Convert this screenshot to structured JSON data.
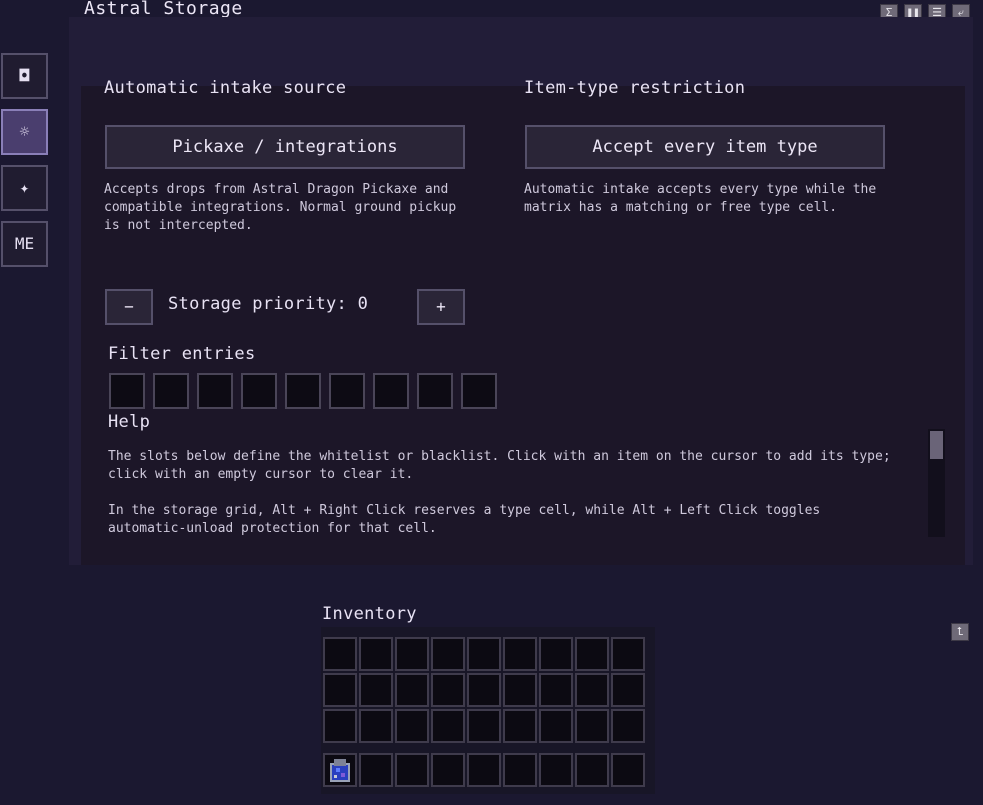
{
  "window": {
    "title": "Astral Storage",
    "controls": [
      "Σ",
      "❚❚",
      "☰",
      "⤶"
    ]
  },
  "sidebar": {
    "tabs": [
      {
        "label": "◘",
        "name": "overview"
      },
      {
        "label": "☼",
        "name": "settings"
      },
      {
        "label": "✦",
        "name": "astral"
      },
      {
        "label": "ME",
        "name": "me-network"
      }
    ]
  },
  "intake": {
    "heading": "Automatic intake source",
    "button_label": "Pickaxe / integrations",
    "description": "Accepts drops from Astral Dragon Pickaxe and compatible integrations. Normal ground pickup is not intercepted."
  },
  "restriction": {
    "heading": "Item-type restriction",
    "button_label": "Accept every item type",
    "description": "Automatic intake accepts every type while the matrix has a matching or free type cell."
  },
  "priority": {
    "minus_label": "−",
    "plus_label": "+",
    "text": "Storage priority: 0"
  },
  "filter": {
    "heading": "Filter entries",
    "slot_count": 9
  },
  "help": {
    "heading": "Help",
    "paragraph1": "The slots below define the whitelist or blacklist. Click with an item on the cursor to add its type; click with an empty cursor to clear it.",
    "paragraph2": "In the storage grid, Alt + Right Click reserves a type cell, while Alt + Left Click toggles automatic-unload protection for that cell."
  },
  "inventory": {
    "heading": "Inventory",
    "sort_icon": "⮤",
    "hotbar_first_item": "astral-crystal-item"
  }
}
